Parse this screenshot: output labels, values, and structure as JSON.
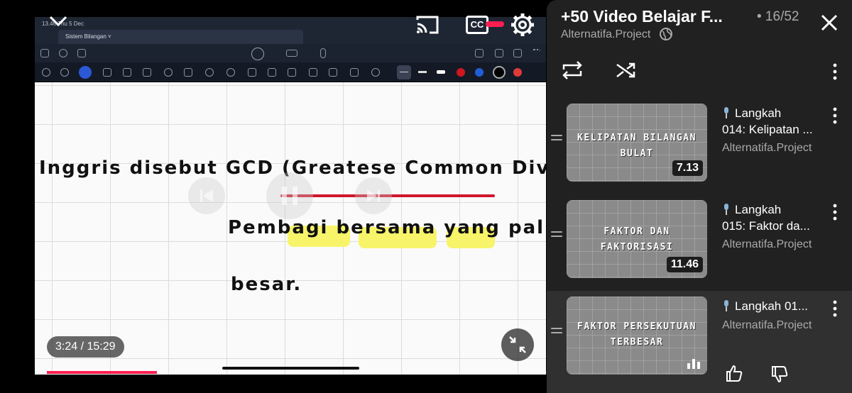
{
  "player": {
    "ipad": {
      "status_time": "13.46  Thu 5 Dec",
      "tab_title": "Sistem Bilangan ˅",
      "handwriting": {
        "line1_start": "Inggris disebut GCD (",
        "line1_highlight": "Greatese Common Divisor",
        "line1_end": ")",
        "line2": "Pembagi bersama yang paling",
        "line3": "besar."
      }
    },
    "time": "3:24 / 15:29",
    "progress_fraction": 0.2196,
    "icons": {
      "collapse": "chevron-down-icon",
      "cast": "cast-icon",
      "captions": "cc-icon",
      "settings": "gear-icon",
      "fullscreen": "exit-fullscreen-icon"
    },
    "captions_label": "CC",
    "accent_color": "#ff1e4f"
  },
  "panel": {
    "playlist_title": "+50 Video Belajar F...",
    "position": "• 16/52",
    "channel": "Alternatifa.Project",
    "items": [
      {
        "thumb_caption_1": "KELIPATAN BILANGAN",
        "thumb_caption_2": "BULAT",
        "duration": "7.13",
        "title_1": "Langkah",
        "title_2": "014: Kelipatan ...",
        "channel": "Alternatifa.Project"
      },
      {
        "thumb_caption_1": "FAKTOR DAN",
        "thumb_caption_2": "FAKTORISASI",
        "duration": "11.46",
        "title_1": "Langkah",
        "title_2": "015: Faktor da...",
        "channel": "Alternatifa.Project"
      },
      {
        "thumb_caption_1": "FAKTOR PERSEKUTUAN",
        "thumb_caption_2": "TERBESAR",
        "duration": "",
        "title_1": "Langkah 01...",
        "title_2": "",
        "channel": "Alternatifa.Project",
        "now_playing": true
      }
    ]
  }
}
